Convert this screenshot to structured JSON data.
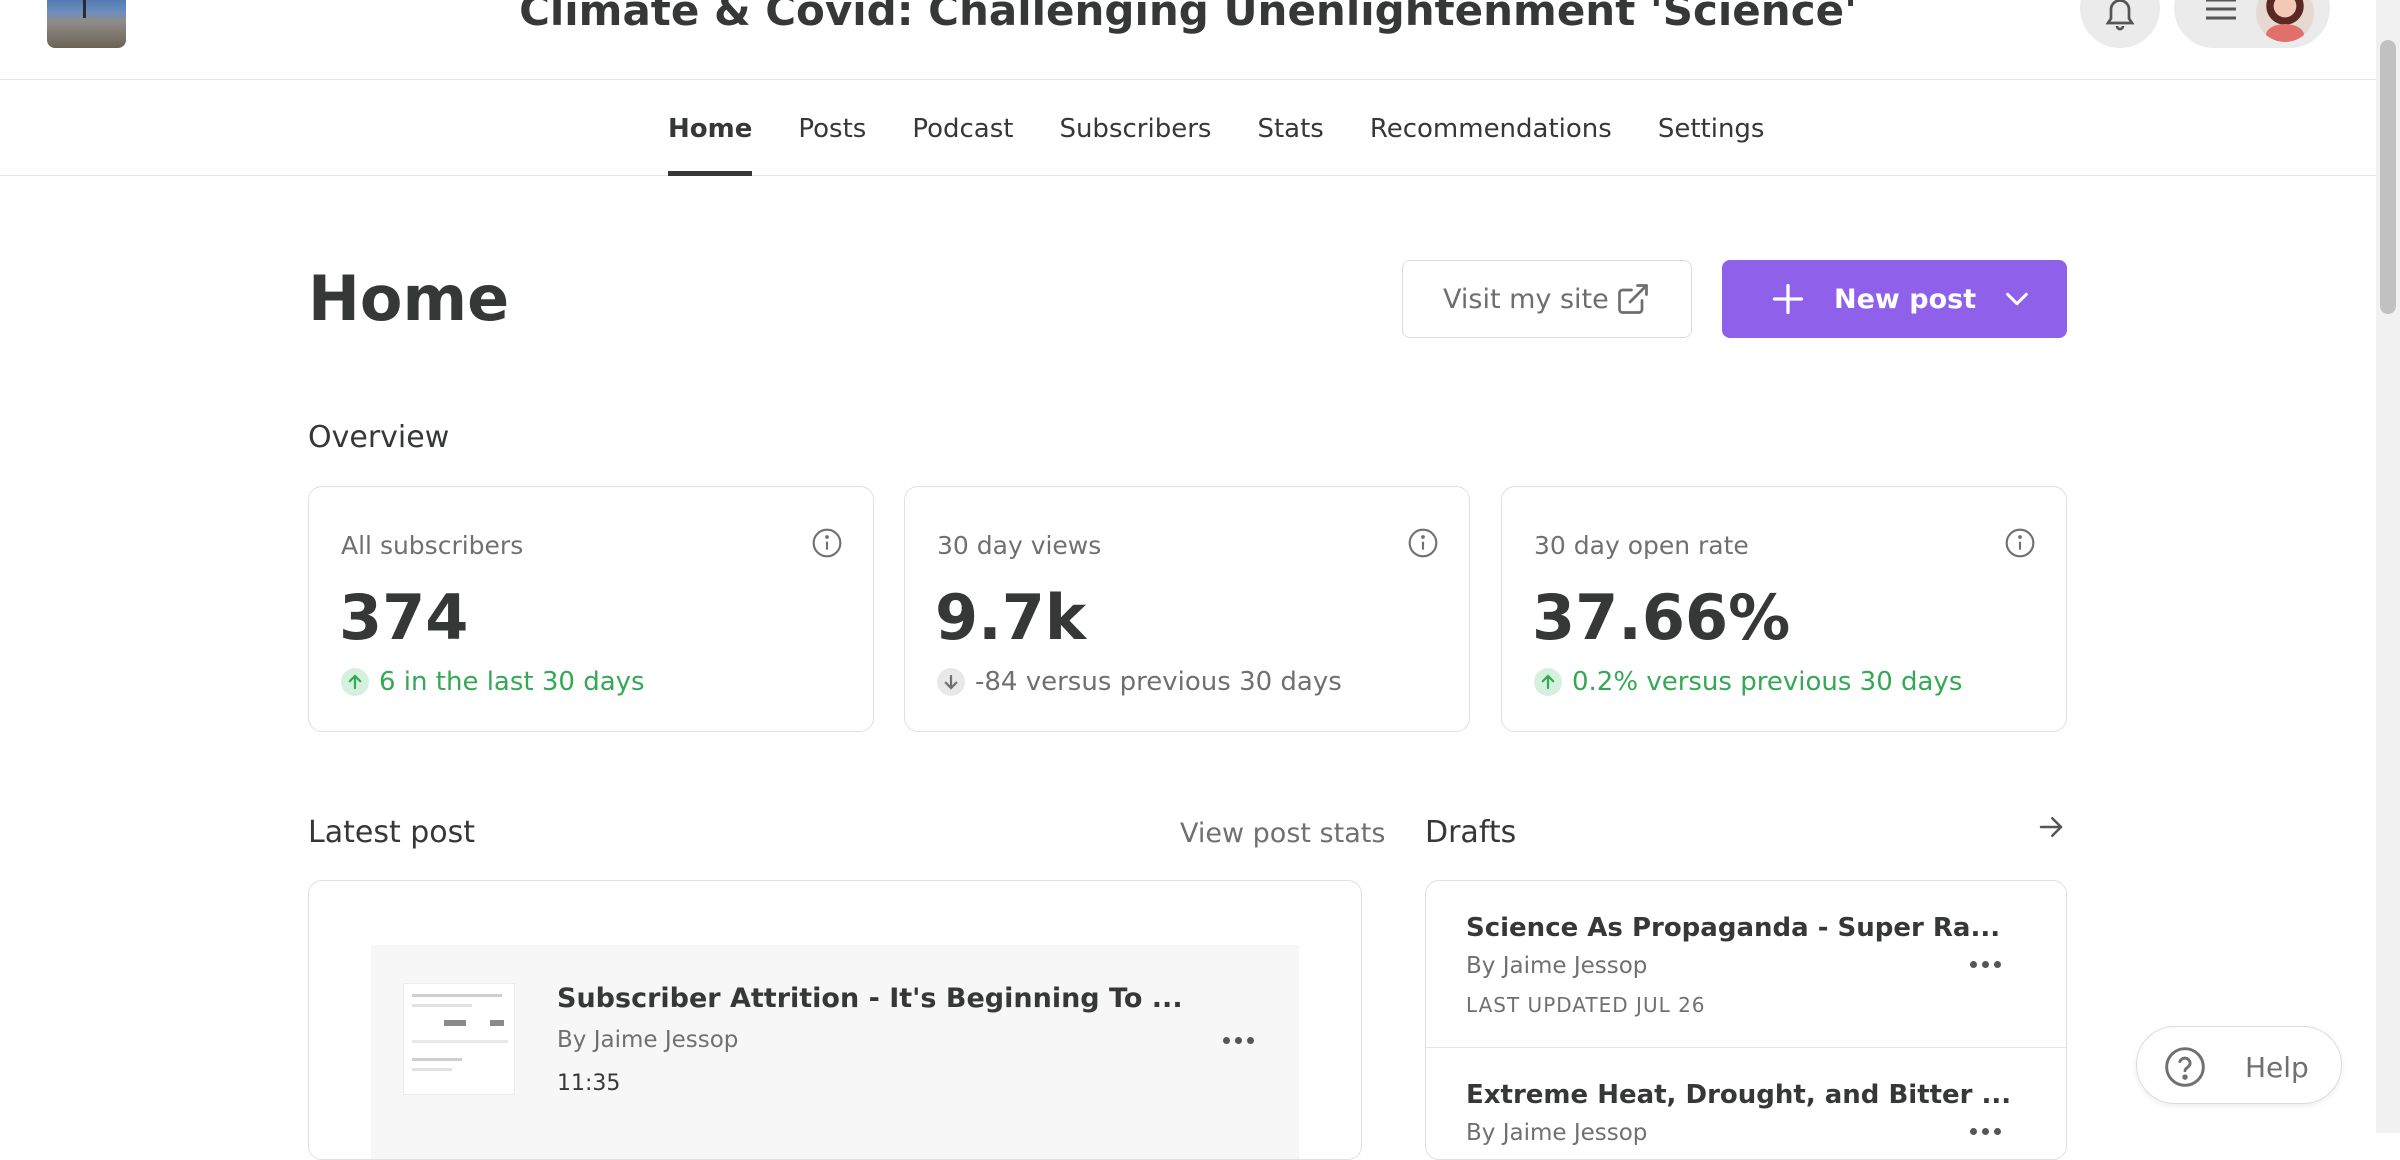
{
  "header": {
    "publication_title": "Climate & Covid: Challenging Unenlightenment 'Science'",
    "icons": {
      "logo": "publication-logo",
      "bell": "bell-icon",
      "menu": "hamburger-menu-icon",
      "avatar": "user-avatar"
    }
  },
  "nav": {
    "items": [
      {
        "label": "Home",
        "active": true
      },
      {
        "label": "Posts"
      },
      {
        "label": "Podcast"
      },
      {
        "label": "Subscribers"
      },
      {
        "label": "Stats"
      },
      {
        "label": "Recommendations"
      },
      {
        "label": "Settings"
      }
    ]
  },
  "page": {
    "title": "Home",
    "visit_site_label": "Visit my site",
    "new_post_label": "New post"
  },
  "overview": {
    "heading": "Overview",
    "cards": [
      {
        "label": "All subscribers",
        "value": "374",
        "trend": "6 in the last 30 days",
        "direction": "up"
      },
      {
        "label": "30 day views",
        "value": "9.7k",
        "trend": "-84 versus previous 30 days",
        "direction": "down"
      },
      {
        "label": "30 day open rate",
        "value": "37.66%",
        "trend": "0.2% versus previous 30 days",
        "direction": "up"
      }
    ]
  },
  "latest_post": {
    "heading": "Latest post",
    "view_stats_label": "View post stats",
    "title": "Subscriber Attrition - It's Beginning To ...",
    "author": "By Jaime Jessop",
    "duration": "11:35"
  },
  "drafts": {
    "heading": "Drafts",
    "items": [
      {
        "title": "Science As Propaganda - Super Ra...",
        "author": "By Jaime Jessop",
        "updated": "LAST UPDATED JUL 26"
      },
      {
        "title": "Extreme Heat, Drought, and Bitter ...",
        "author": "By Jaime Jessop",
        "updated": ""
      }
    ]
  },
  "help": {
    "label": "Help"
  },
  "colors": {
    "accent": "#8f60ea",
    "positive": "#35a855",
    "text": "#363737",
    "muted": "#707070"
  }
}
